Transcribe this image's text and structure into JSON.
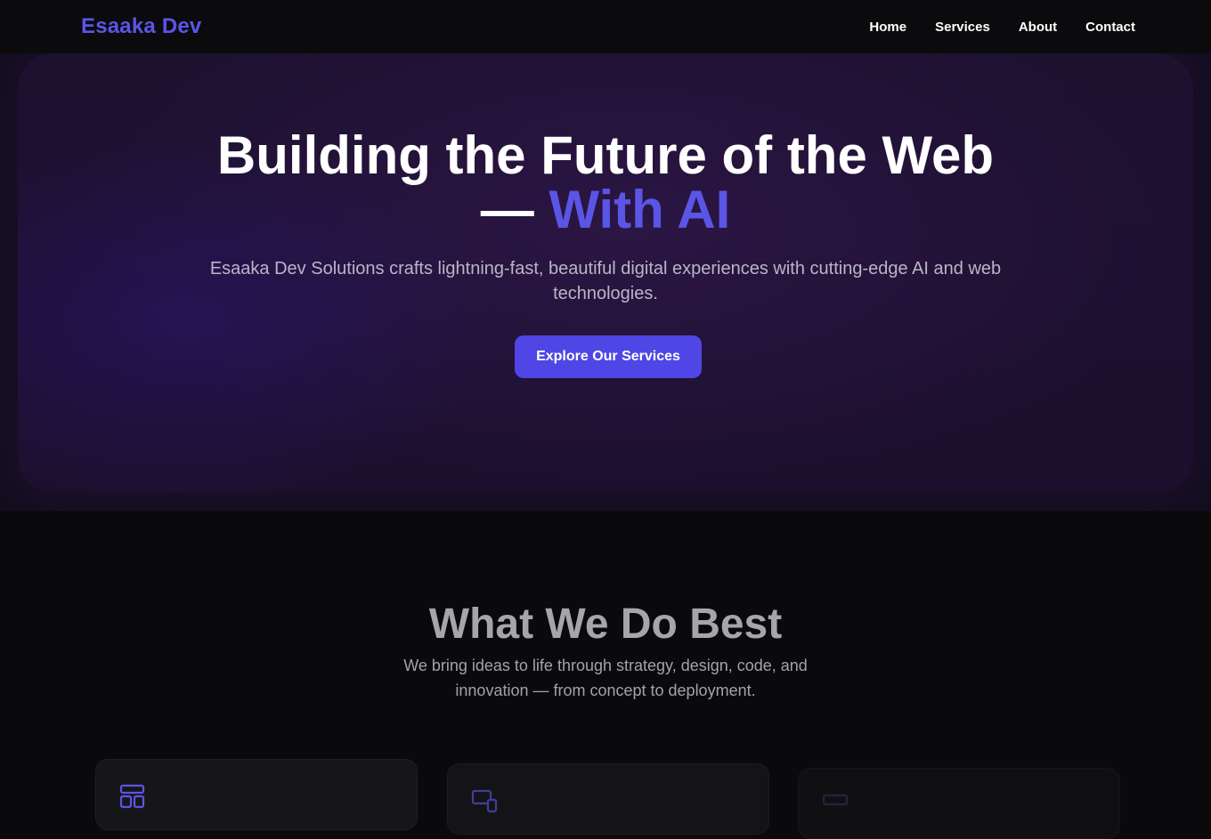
{
  "nav": {
    "brand": "Esaaka Dev",
    "links": [
      "Home",
      "Services",
      "About",
      "Contact"
    ]
  },
  "hero": {
    "title_line1": "Building the Future of the Web",
    "title_line2_prefix": "— ",
    "title_line2_accent": "With AI",
    "subtitle": "Esaaka Dev Solutions crafts lightning-fast, beautiful digital experiences with cutting-edge AI and web technologies.",
    "cta_label": "Explore Our Services"
  },
  "services": {
    "title": "What We Do Best",
    "subtitle": "We bring ideas to life through strategy, design, code, and innovation — from concept to deployment.",
    "cards": [
      {
        "icon": "layout-icon"
      },
      {
        "icon": "devices-icon"
      },
      {
        "icon": "window-icon"
      }
    ]
  },
  "colors": {
    "accent": "#5b55e6",
    "button": "#4f46e5",
    "background": "#0a0a0c",
    "hero_background": "#1b1030"
  }
}
